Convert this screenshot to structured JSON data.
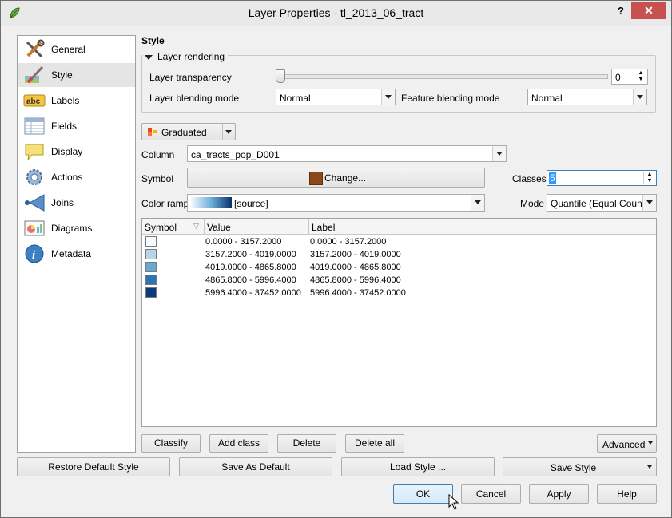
{
  "window": {
    "title": "Layer Properties - tl_2013_06_tract",
    "help": "?",
    "close": "✕"
  },
  "sidebar": {
    "items": [
      {
        "label": "General",
        "icon": "tools-icon"
      },
      {
        "label": "Style",
        "icon": "paintbrush-icon"
      },
      {
        "label": "Labels",
        "icon": "abc-label-icon"
      },
      {
        "label": "Fields",
        "icon": "table-icon"
      },
      {
        "label": "Display",
        "icon": "speech-bubble-icon"
      },
      {
        "label": "Actions",
        "icon": "gear-icon"
      },
      {
        "label": "Joins",
        "icon": "join-arrow-icon"
      },
      {
        "label": "Diagrams",
        "icon": "chart-icon"
      },
      {
        "label": "Metadata",
        "icon": "info-icon"
      }
    ],
    "selected": "Style"
  },
  "style": {
    "heading": "Style",
    "rendering": {
      "title": "Layer rendering",
      "transparency_label": "Layer transparency",
      "transparency_value": "0",
      "transparency_level": 0,
      "blend_label": "Layer blending mode",
      "blend_value": "Normal",
      "feature_blend_label": "Feature blending mode",
      "feature_blend_value": "Normal"
    },
    "renderer": "Graduated",
    "column_label": "Column",
    "column_value": "ca_tracts_pop_D001",
    "symbol_label": "Symbol",
    "symbol_button": "Change...",
    "symbol_color": "#8b4a1c",
    "classes_label": "Classes",
    "classes_value": "5",
    "ramp_label": "Color ramp",
    "ramp_value": "[source]",
    "mode_label": "Mode",
    "mode_value": "Quantile (Equal Count)",
    "table": {
      "headers": [
        "Symbol",
        "Value",
        "Label"
      ],
      "rows": [
        {
          "color": "#f7fbff",
          "value": "0.0000 - 3157.2000",
          "label": "0.0000 - 3157.2000"
        },
        {
          "color": "#b8d4ea",
          "value": "3157.2000 - 4019.0000",
          "label": "3157.2000 - 4019.0000"
        },
        {
          "color": "#68a8d2",
          "value": "4019.0000 - 4865.8000",
          "label": "4019.0000 - 4865.8000"
        },
        {
          "color": "#2c75b4",
          "value": "4865.8000 - 5996.4000",
          "label": "4865.8000 - 5996.4000"
        },
        {
          "color": "#0a3b7e",
          "value": "5996.4000 - 37452.0000",
          "label": "5996.4000 - 37452.0000"
        }
      ]
    },
    "buttons": {
      "classify": "Classify",
      "add_class": "Add class",
      "delete": "Delete",
      "delete_all": "Delete all",
      "advanced": "Advanced"
    }
  },
  "footer": {
    "restore": "Restore Default Style",
    "save_default": "Save As Default",
    "load": "Load Style ...",
    "save_style": "Save Style",
    "ok": "OK",
    "cancel": "Cancel",
    "apply": "Apply",
    "help": "Help"
  }
}
